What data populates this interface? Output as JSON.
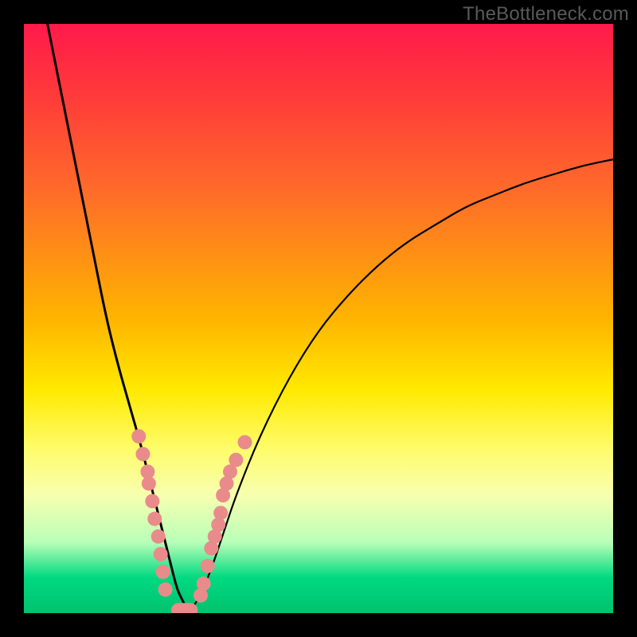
{
  "watermark": "TheBottleneck.com",
  "chart_data": {
    "type": "line",
    "title": "",
    "xlabel": "",
    "ylabel": "",
    "xlim": [
      0,
      100
    ],
    "ylim": [
      0,
      100
    ],
    "series": [
      {
        "name": "left-curve",
        "x": [
          4,
          6,
          8,
          10,
          12,
          14,
          16,
          18,
          20,
          22,
          23,
          24,
          25,
          26,
          27,
          28
        ],
        "y": [
          100,
          90,
          80,
          70,
          60,
          50,
          42,
          35,
          28,
          20,
          16,
          12,
          8,
          4,
          2,
          0
        ]
      },
      {
        "name": "right-curve",
        "x": [
          28,
          30,
          32,
          34,
          36,
          40,
          45,
          50,
          55,
          60,
          65,
          70,
          75,
          80,
          85,
          90,
          95,
          100
        ],
        "y": [
          0,
          3,
          8,
          14,
          20,
          30,
          40,
          48,
          54,
          59,
          63,
          66,
          69,
          71,
          73,
          74.5,
          76,
          77
        ]
      }
    ],
    "markers": {
      "color": "#e98b8b",
      "radius_px": 9,
      "left_cluster_x": [
        19.5,
        20.2,
        21.0,
        21.2,
        21.8,
        22.2,
        22.8,
        23.2,
        23.6,
        24.0
      ],
      "left_cluster_y": [
        30,
        27,
        24,
        22,
        19,
        16,
        13,
        10,
        7,
        4
      ],
      "right_cluster_x": [
        30.0,
        30.5,
        31.2,
        31.8,
        32.4,
        33.0,
        33.4,
        33.8,
        34.4,
        35.0,
        36.0,
        37.5
      ],
      "right_cluster_y": [
        3,
        5,
        8,
        11,
        13,
        15,
        17,
        20,
        22,
        24,
        26,
        29
      ],
      "bottom_bar": {
        "x0": 25.0,
        "x1": 29.5,
        "y": 0.5,
        "thickness_px": 18
      }
    },
    "gradient_stops": [
      {
        "pos": 0.0,
        "color": "#ff1a4b"
      },
      {
        "pos": 0.12,
        "color": "#ff3a3a"
      },
      {
        "pos": 0.28,
        "color": "#ff6a2a"
      },
      {
        "pos": 0.5,
        "color": "#ffb400"
      },
      {
        "pos": 0.62,
        "color": "#ffe900"
      },
      {
        "pos": 0.72,
        "color": "#fffc6a"
      },
      {
        "pos": 0.8,
        "color": "#f7ffb0"
      },
      {
        "pos": 0.88,
        "color": "#b8ffb8"
      },
      {
        "pos": 0.94,
        "color": "#00d980"
      },
      {
        "pos": 1.0,
        "color": "#00c26f"
      }
    ]
  }
}
